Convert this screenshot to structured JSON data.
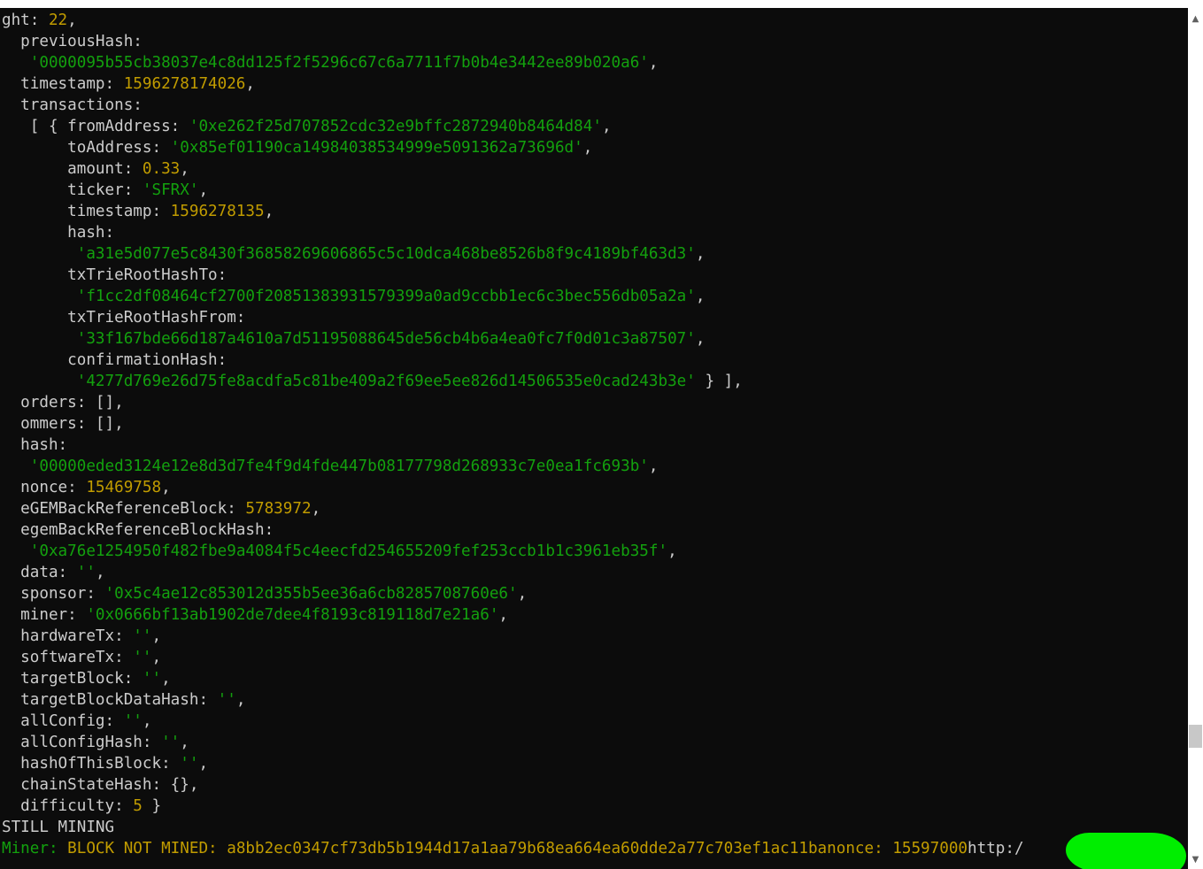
{
  "terminal": {
    "lines": [
      [
        {
          "t": "ght: ",
          "c": "k"
        },
        {
          "t": "22",
          "c": "n"
        },
        {
          "t": ",",
          "c": "p"
        }
      ],
      [
        {
          "t": "  previousHash:",
          "c": "k"
        }
      ],
      [
        {
          "t": "   ",
          "c": "k"
        },
        {
          "t": "'0000095b55cb38037e4c8dd125f2f5296c67c6a7711f7b0b4e3442ee89b020a6'",
          "c": "s"
        },
        {
          "t": ",",
          "c": "p"
        }
      ],
      [
        {
          "t": "  timestamp: ",
          "c": "k"
        },
        {
          "t": "1596278174026",
          "c": "n"
        },
        {
          "t": ",",
          "c": "p"
        }
      ],
      [
        {
          "t": "  transactions:",
          "c": "k"
        }
      ],
      [
        {
          "t": "   [ { fromAddress: ",
          "c": "k"
        },
        {
          "t": "'0xe262f25d707852cdc32e9bffc2872940b8464d84'",
          "c": "s"
        },
        {
          "t": ",",
          "c": "p"
        }
      ],
      [
        {
          "t": "       toAddress: ",
          "c": "k"
        },
        {
          "t": "'0x85ef01190ca14984038534999e5091362a73696d'",
          "c": "s"
        },
        {
          "t": ",",
          "c": "p"
        }
      ],
      [
        {
          "t": "       amount: ",
          "c": "k"
        },
        {
          "t": "0.33",
          "c": "n"
        },
        {
          "t": ",",
          "c": "p"
        }
      ],
      [
        {
          "t": "       ticker: ",
          "c": "k"
        },
        {
          "t": "'SFRX'",
          "c": "s"
        },
        {
          "t": ",",
          "c": "p"
        }
      ],
      [
        {
          "t": "       timestamp: ",
          "c": "k"
        },
        {
          "t": "1596278135",
          "c": "n"
        },
        {
          "t": ",",
          "c": "p"
        }
      ],
      [
        {
          "t": "       hash:",
          "c": "k"
        }
      ],
      [
        {
          "t": "        ",
          "c": "k"
        },
        {
          "t": "'a31e5d077e5c8430f36858269606865c5c10dca468be8526b8f9c4189bf463d3'",
          "c": "s"
        },
        {
          "t": ",",
          "c": "p"
        }
      ],
      [
        {
          "t": "       txTrieRootHashTo:",
          "c": "k"
        }
      ],
      [
        {
          "t": "        ",
          "c": "k"
        },
        {
          "t": "'f1cc2df08464cf2700f20851383931579399a0ad9ccbb1ec6c3bec556db05a2a'",
          "c": "s"
        },
        {
          "t": ",",
          "c": "p"
        }
      ],
      [
        {
          "t": "       txTrieRootHashFrom:",
          "c": "k"
        }
      ],
      [
        {
          "t": "        ",
          "c": "k"
        },
        {
          "t": "'33f167bde66d187a4610a7d51195088645de56cb4b6a4ea0fc7f0d01c3a87507'",
          "c": "s"
        },
        {
          "t": ",",
          "c": "p"
        }
      ],
      [
        {
          "t": "       confirmationHash:",
          "c": "k"
        }
      ],
      [
        {
          "t": "        ",
          "c": "k"
        },
        {
          "t": "'4277d769e26d75fe8acdfa5c81be409a2f69ee5ee826d14506535e0cad243b3e'",
          "c": "s"
        },
        {
          "t": " } ],",
          "c": "p"
        }
      ],
      [
        {
          "t": "  orders: [],",
          "c": "k"
        }
      ],
      [
        {
          "t": "  ommers: [],",
          "c": "k"
        }
      ],
      [
        {
          "t": "  hash:",
          "c": "k"
        }
      ],
      [
        {
          "t": "   ",
          "c": "k"
        },
        {
          "t": "'00000eded3124e12e8d3d7fe4f9d4fde447b08177798d268933c7e0ea1fc693b'",
          "c": "s"
        },
        {
          "t": ",",
          "c": "p"
        }
      ],
      [
        {
          "t": "  nonce: ",
          "c": "k"
        },
        {
          "t": "15469758",
          "c": "n"
        },
        {
          "t": ",",
          "c": "p"
        }
      ],
      [
        {
          "t": "  eGEMBackReferenceBlock: ",
          "c": "k"
        },
        {
          "t": "5783972",
          "c": "n"
        },
        {
          "t": ",",
          "c": "p"
        }
      ],
      [
        {
          "t": "  egemBackReferenceBlockHash:",
          "c": "k"
        }
      ],
      [
        {
          "t": "   ",
          "c": "k"
        },
        {
          "t": "'0xa76e1254950f482fbe9a4084f5c4eecfd254655209fef253ccb1b1c3961eb35f'",
          "c": "s"
        },
        {
          "t": ",",
          "c": "p"
        }
      ],
      [
        {
          "t": "  data: ",
          "c": "k"
        },
        {
          "t": "''",
          "c": "s"
        },
        {
          "t": ",",
          "c": "p"
        }
      ],
      [
        {
          "t": "  sponsor: ",
          "c": "k"
        },
        {
          "t": "'0x5c4ae12c853012d355b5ee36a6cb8285708760e6'",
          "c": "s"
        },
        {
          "t": ",",
          "c": "p"
        }
      ],
      [
        {
          "t": "  miner: ",
          "c": "k"
        },
        {
          "t": "'0x0666bf13ab1902de7dee4f8193c819118d7e21a6'",
          "c": "s"
        },
        {
          "t": ",",
          "c": "p"
        }
      ],
      [
        {
          "t": "  hardwareTx: ",
          "c": "k"
        },
        {
          "t": "''",
          "c": "s"
        },
        {
          "t": ",",
          "c": "p"
        }
      ],
      [
        {
          "t": "  softwareTx: ",
          "c": "k"
        },
        {
          "t": "''",
          "c": "s"
        },
        {
          "t": ",",
          "c": "p"
        }
      ],
      [
        {
          "t": "  targetBlock: ",
          "c": "k"
        },
        {
          "t": "''",
          "c": "s"
        },
        {
          "t": ",",
          "c": "p"
        }
      ],
      [
        {
          "t": "  targetBlockDataHash: ",
          "c": "k"
        },
        {
          "t": "''",
          "c": "s"
        },
        {
          "t": ",",
          "c": "p"
        }
      ],
      [
        {
          "t": "  allConfig: ",
          "c": "k"
        },
        {
          "t": "''",
          "c": "s"
        },
        {
          "t": ",",
          "c": "p"
        }
      ],
      [
        {
          "t": "  allConfigHash: ",
          "c": "k"
        },
        {
          "t": "''",
          "c": "s"
        },
        {
          "t": ",",
          "c": "p"
        }
      ],
      [
        {
          "t": "  hashOfThisBlock: ",
          "c": "k"
        },
        {
          "t": "''",
          "c": "s"
        },
        {
          "t": ",",
          "c": "p"
        }
      ],
      [
        {
          "t": "  chainStateHash: {},",
          "c": "k"
        }
      ],
      [
        {
          "t": "  difficulty: ",
          "c": "k"
        },
        {
          "t": "5",
          "c": "n"
        },
        {
          "t": " }",
          "c": "p"
        }
      ],
      [
        {
          "t": "STILL MINING",
          "c": "k"
        }
      ],
      [
        {
          "t": "Miner: ",
          "c": "g"
        },
        {
          "t": "BLOCK NOT MINED: a8bb2ec0347cf73db5b1944d17a1aa79b68ea664ea60dde2a77c703ef1ac11banonce: 15597000",
          "c": "y"
        },
        {
          "t": "http:/",
          "c": "k"
        }
      ]
    ]
  },
  "colors": {
    "background": "#0c0c0c",
    "default_text": "#cccccc",
    "string": "#13a10e",
    "number": "#c19c00",
    "redaction": "#00ee00"
  },
  "scrollbar": {
    "up_icon": "▲",
    "down_icon": "▼"
  }
}
